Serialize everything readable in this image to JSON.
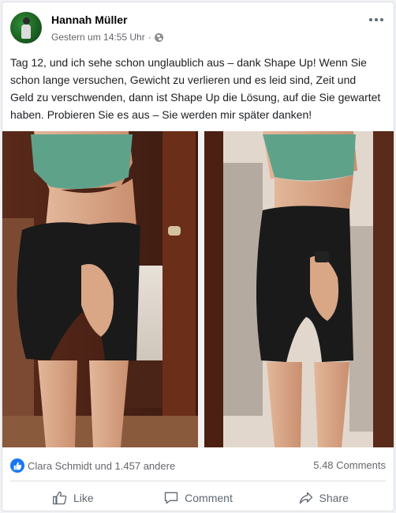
{
  "post": {
    "author": "Hannah Müller",
    "timestamp": "Gestern um 14:55 Uhr",
    "audience_separator": "·",
    "audience_icon": "globe-icon",
    "body": "Tag 12, und ich sehe schon unglaublich aus – dank Shape Up! Wenn Sie schon lange versuchen, Gewicht zu verlieren und es leid sind, Zeit und Geld zu verschwenden, dann ist Shape Up die Lösung, auf die Sie gewartet haben. Probieren Sie es aus – Sie werden mir später danken!",
    "image_description": "before-after-comparison-photo"
  },
  "stats": {
    "reactions": "Clara Schmidt und 1.457 andere",
    "comments": "5.48 Comments"
  },
  "actions": {
    "like_label": "Like",
    "comment_label": "Comment",
    "share_label": "Share"
  },
  "colors": {
    "accent": "#1877f2",
    "text_primary": "#050505",
    "text_secondary": "#65676b"
  }
}
